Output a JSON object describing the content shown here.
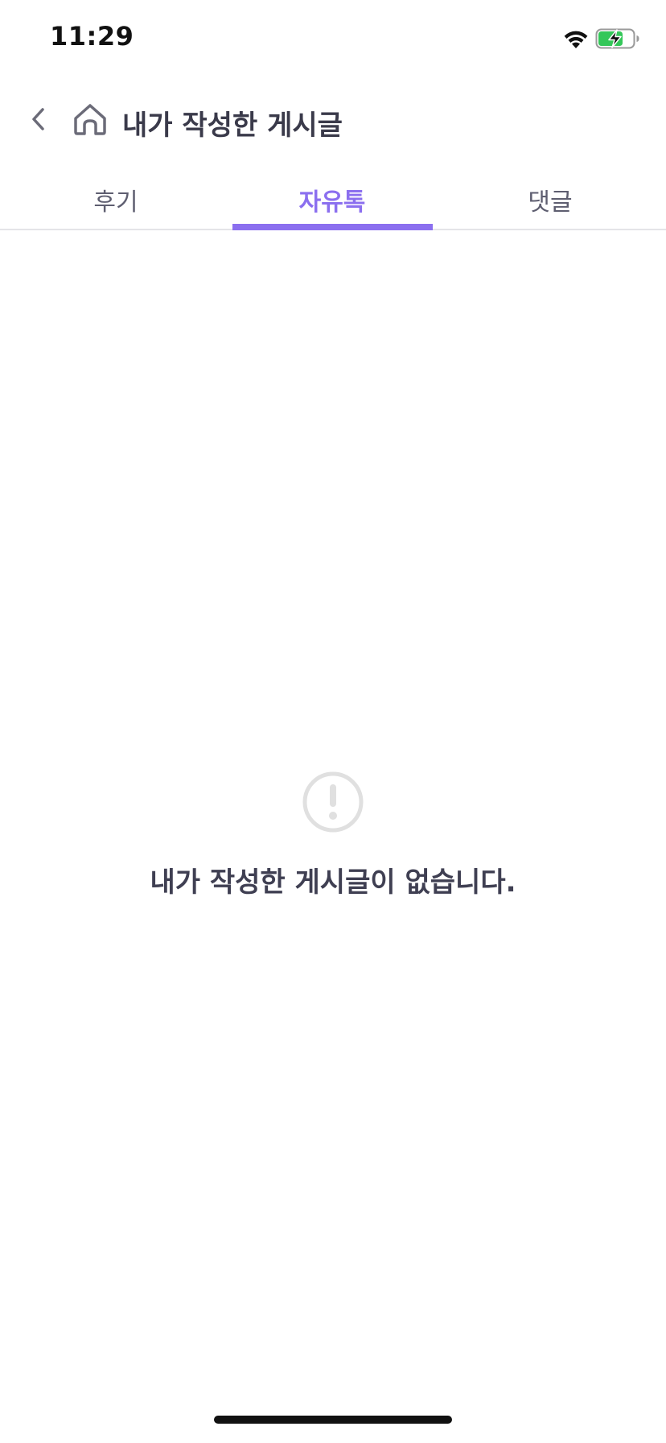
{
  "status_bar": {
    "time": "11:29",
    "wifi_icon": "wifi-icon",
    "battery_icon": "battery-charging-icon",
    "battery_color": "#34c759"
  },
  "header": {
    "back_icon": "chevron-left-icon",
    "home_icon": "home-icon",
    "title": "내가 작성한 게시글"
  },
  "tabs": {
    "items": [
      {
        "label": "후기",
        "active": false
      },
      {
        "label": "자유톡",
        "active": true
      },
      {
        "label": "댓글",
        "active": false
      }
    ],
    "accent_color": "#8b6fef"
  },
  "empty_state": {
    "icon": "alert-circle-icon",
    "message": "내가 작성한 게시글이 없습니다."
  }
}
